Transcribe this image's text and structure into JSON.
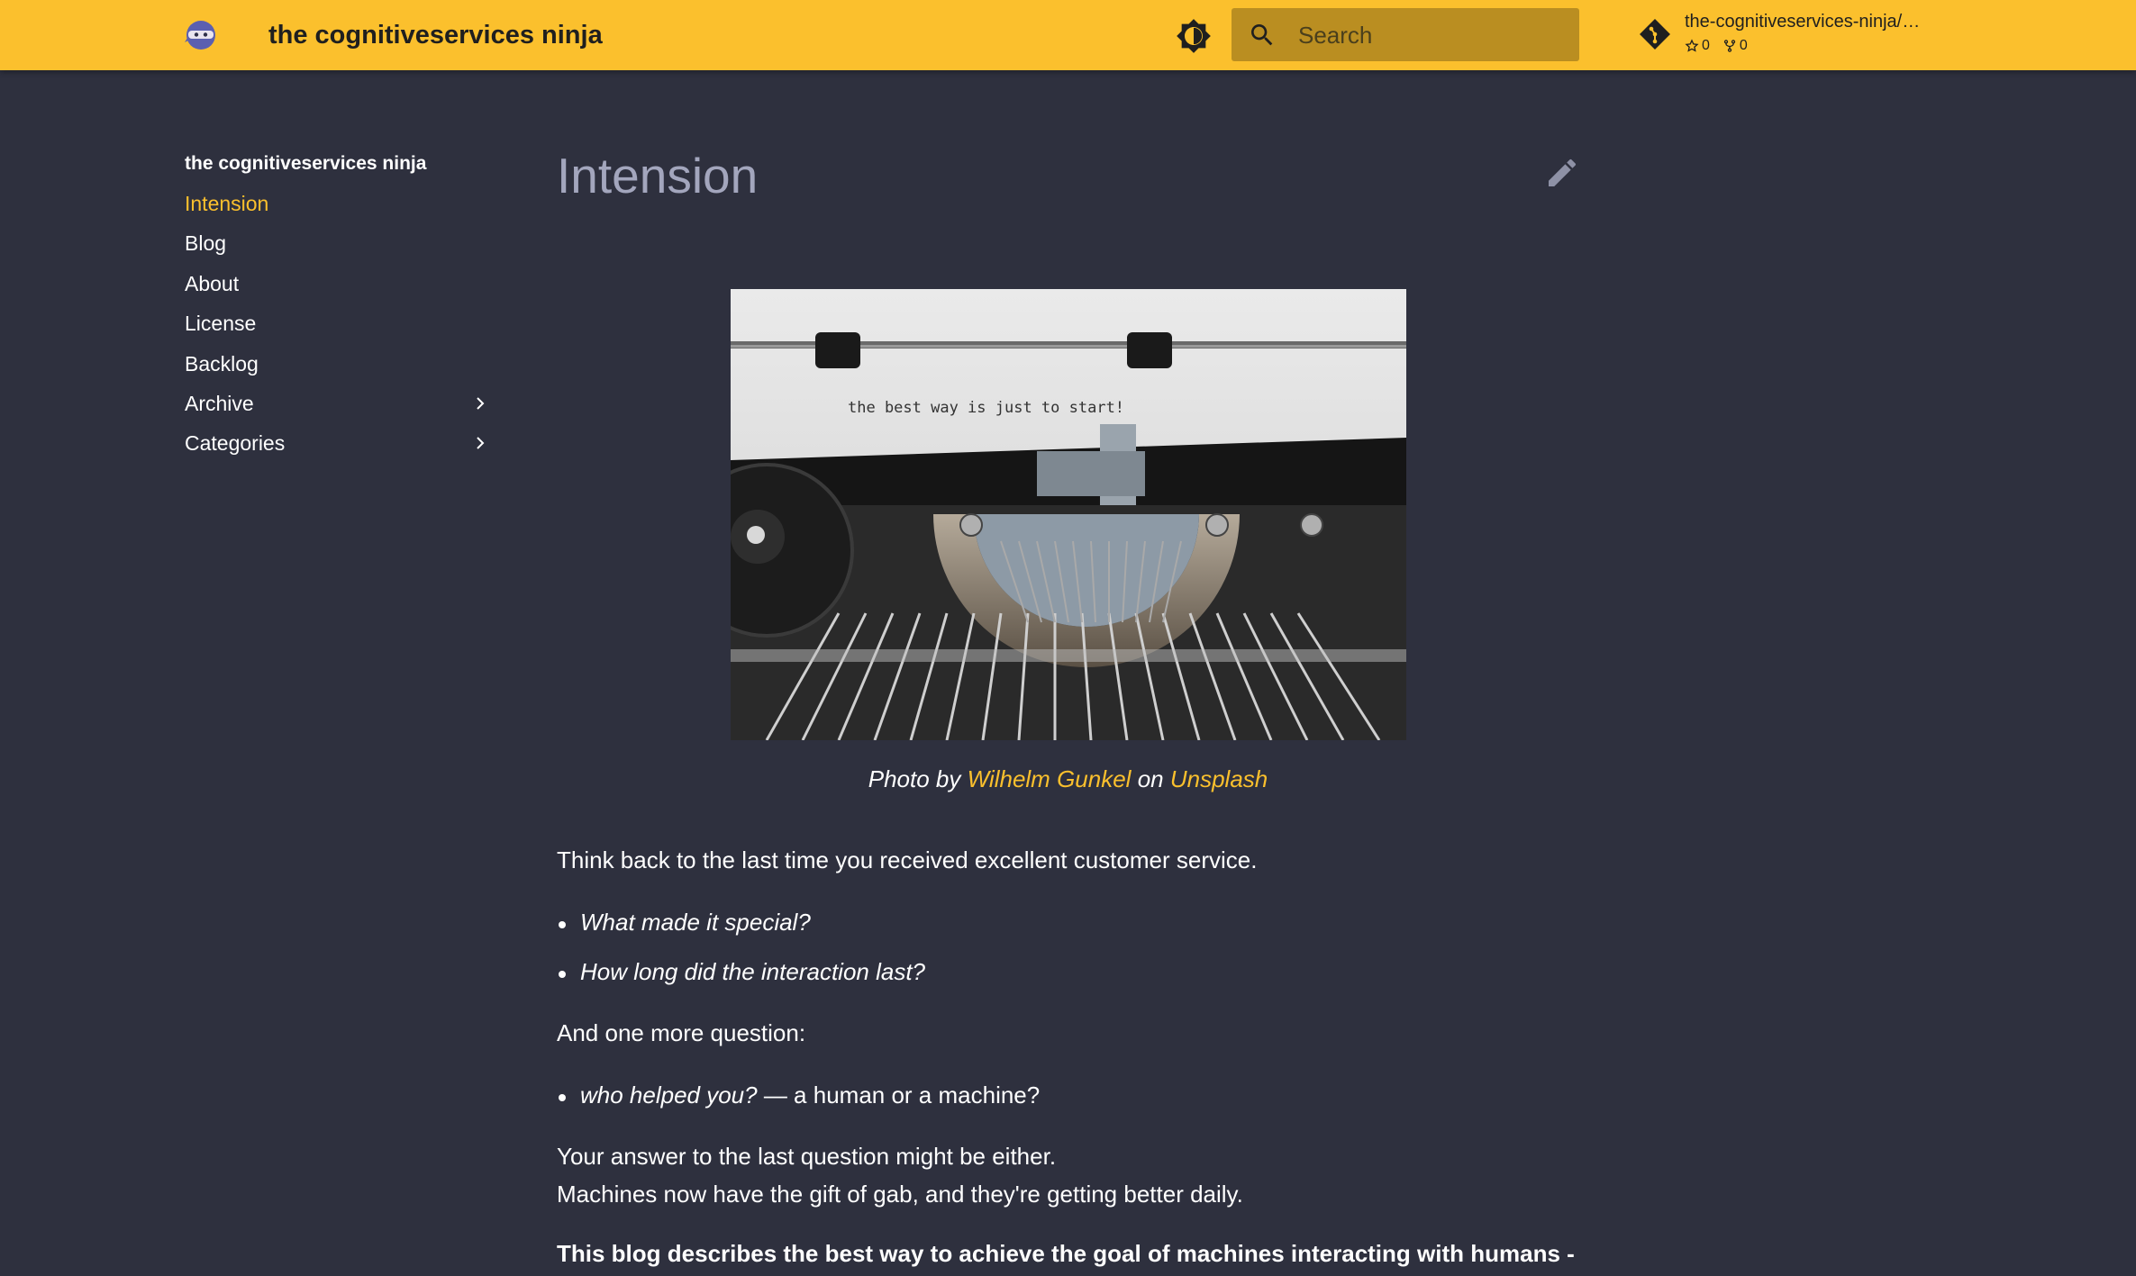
{
  "header": {
    "site_title": "the cognitiveservices ninja",
    "search_placeholder": "Search",
    "repo": {
      "name": "the-cognitiveservices-ninja/…",
      "stars": "0",
      "forks": "0"
    },
    "accent_color": "#fbc02d"
  },
  "sidebar": {
    "title": "the cognitiveservices ninja",
    "items": [
      {
        "label": "Intension",
        "active": true
      },
      {
        "label": "Blog"
      },
      {
        "label": "About"
      },
      {
        "label": "License"
      },
      {
        "label": "Backlog"
      },
      {
        "label": "Archive",
        "expandable": true
      },
      {
        "label": "Categories",
        "expandable": true
      }
    ]
  },
  "main": {
    "title": "Intension",
    "image_typed_text": "the best way is just to start!",
    "caption": {
      "prefix": "Photo by",
      "author": "Wilhelm Gunkel",
      "middle": "on",
      "source": "Unsplash"
    },
    "paragraph1": "Think back to the last time you received excellent customer service.",
    "bullets1": [
      "What made it special?",
      "How long did the interaction last?"
    ],
    "paragraph2": "And one more question:",
    "bullet3_em": "who helped you?",
    "bullet3_rest": " — a human or a machine?",
    "paragraph3": "Your answer to the last question might be either.",
    "paragraph4": "Machines now have the gift of gab, and they're getting better daily.",
    "paragraph5": "This blog describes the best way to achieve the goal of machines interacting with humans -"
  }
}
